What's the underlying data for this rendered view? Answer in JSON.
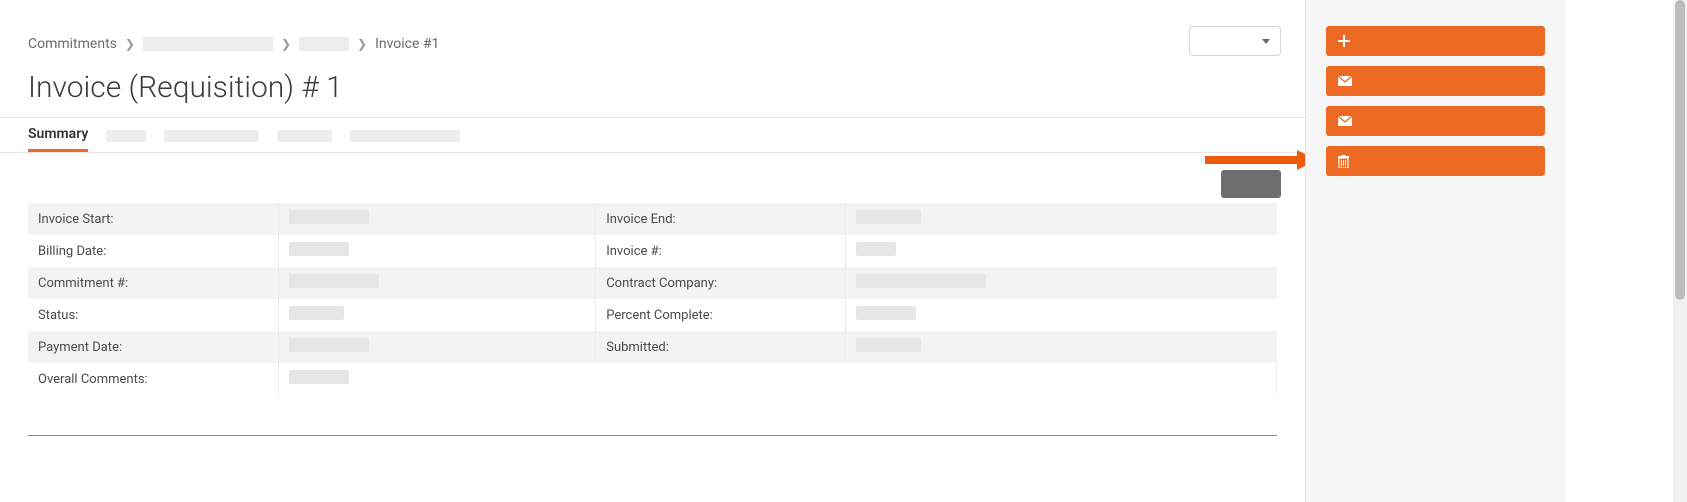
{
  "breadcrumb": {
    "root": "Commitments",
    "current": "Invoice #1"
  },
  "page_title": "Invoice (Requisition) # 1",
  "tabs": {
    "active": "Summary"
  },
  "fields": {
    "invoice_start_label": "Invoice Start:",
    "invoice_end_label": "Invoice End:",
    "billing_date_label": "Billing Date:",
    "invoice_num_label": "Invoice #:",
    "commitment_num_label": "Commitment #:",
    "contract_company_label": "Contract Company:",
    "status_label": "Status:",
    "percent_complete_label": "Percent Complete:",
    "payment_date_label": "Payment Date:",
    "submitted_label": "Submitted:",
    "overall_comments_label": "Overall Comments:"
  },
  "sidebar_actions": {
    "create": "",
    "email1": "",
    "email2": "",
    "delete": ""
  },
  "colors": {
    "accent": "#ec6a24",
    "grey_button": "#6e6e6e"
  }
}
